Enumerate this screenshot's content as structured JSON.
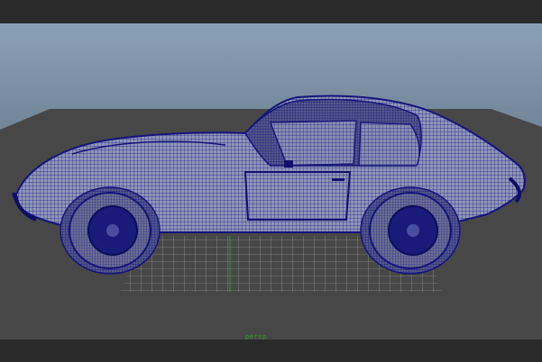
{
  "app": {
    "type": "3d-viewport",
    "view": "perspective",
    "shading": "wireframe-on-shaded"
  },
  "scene": {
    "object": "sports-coupe-mesh",
    "background_gradient": [
      "#8aa0b6",
      "#41505e"
    ],
    "floor_color": "#4a4a4a",
    "wire_color": "#1e1e9a",
    "body_color": "#8a92b0",
    "grid_color": "#c8c8c8"
  },
  "hud": {
    "axis_label": "persp"
  }
}
